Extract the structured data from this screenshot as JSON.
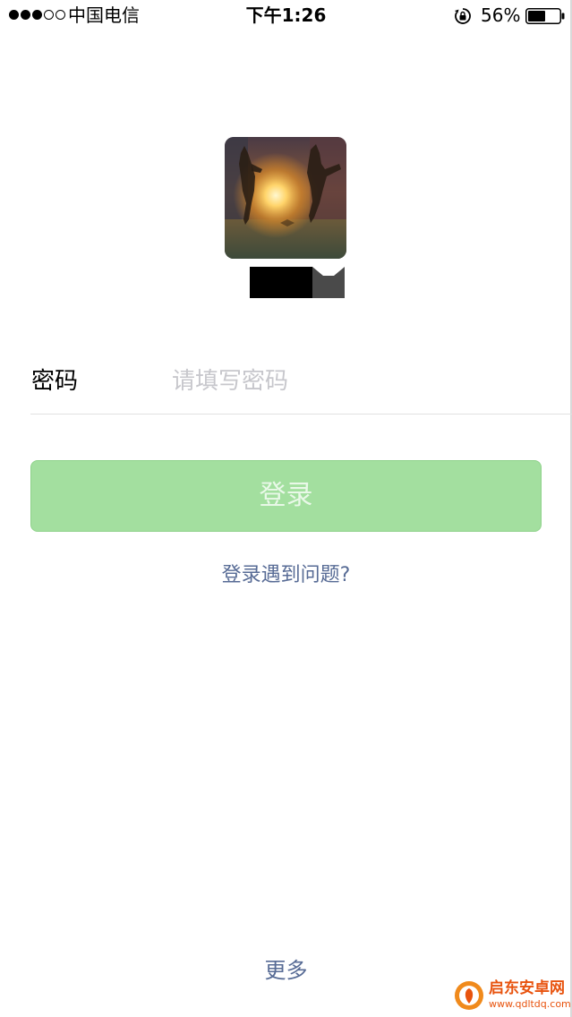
{
  "status_bar": {
    "carrier": "中国电信",
    "time": "下午1:26",
    "battery_percent": "56%",
    "battery_level": 0.56,
    "signal_bars_filled": 3,
    "signal_bars_total": 5,
    "icons": [
      "rotation-lock-icon",
      "battery-icon"
    ]
  },
  "profile": {
    "avatar": "avatar-photo",
    "username_redacted": true
  },
  "form": {
    "password_label": "密码",
    "password_placeholder": "请填写密码",
    "password_value": ""
  },
  "actions": {
    "login_label": "登录",
    "trouble_label": "登录遇到问题?",
    "more_label": "更多"
  },
  "colors": {
    "button_bg": "#a3df9f",
    "button_text": "#e9f8e8",
    "link": "#576b95",
    "placeholder": "#c7c7cc",
    "divider": "#e1e1e1"
  },
  "watermark": {
    "title": "启东安卓网",
    "url": "www.qdltdq.com"
  }
}
